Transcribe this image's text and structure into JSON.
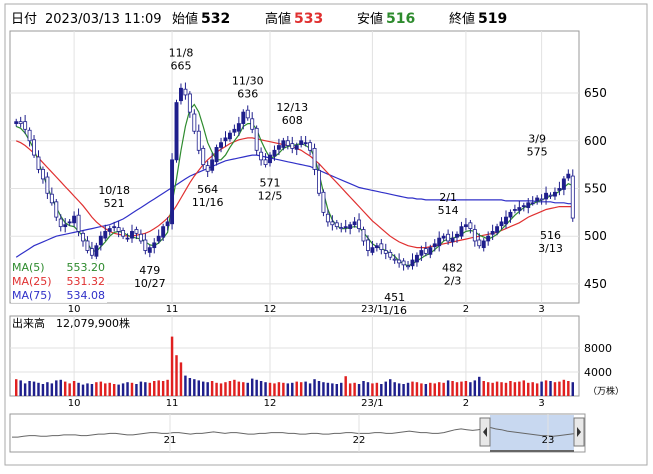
{
  "header": {
    "date_label": "日付",
    "datetime": "2023/03/13 11:09",
    "open_label": "始値",
    "open": "532",
    "high_label": "高値",
    "high": "533",
    "low_label": "安値",
    "low": "516",
    "close_label": "終値",
    "close": "519"
  },
  "colors": {
    "up_candle": "#1f1f8c",
    "down_candle": "#ffffff",
    "ma5": "#2e8b2e",
    "ma25": "#e03030",
    "ma75": "#3030c8",
    "volume": "#e02020",
    "high_text": "#e03030",
    "low_text": "#2e8b2e"
  },
  "chart_data": [
    {
      "type": "candlestick",
      "ylim": [
        430,
        715
      ],
      "yticks": [
        450,
        500,
        550,
        600,
        650
      ],
      "x_tick_labels": [
        "10",
        "11",
        "12",
        "23/1",
        "2",
        "3"
      ],
      "ma_legend": [
        {
          "label": "MA(5)",
          "value": "553.20"
        },
        {
          "label": "MA(25)",
          "value": "531.32"
        },
        {
          "label": "MA(75)",
          "value": "534.08"
        }
      ],
      "annotations": [
        {
          "date": "10/18",
          "value": "521"
        },
        {
          "date": "11/8",
          "value": "665"
        },
        {
          "date": "10/27",
          "value": "479"
        },
        {
          "date": "11/16",
          "value": "564"
        },
        {
          "date": "11/30",
          "value": "636"
        },
        {
          "date": "12/5",
          "value": "571"
        },
        {
          "date": "12/13",
          "value": "608"
        },
        {
          "date": "1/16",
          "value": "451"
        },
        {
          "date": "2/1",
          "value": "514"
        },
        {
          "date": "2/3",
          "value": "482"
        },
        {
          "date": "3/9",
          "value": "575"
        },
        {
          "date": "3/13",
          "value": "516"
        }
      ],
      "closes": [
        620,
        618,
        612,
        600,
        585,
        570,
        560,
        545,
        535,
        520,
        510,
        512,
        515,
        521,
        505,
        495,
        485,
        480,
        490,
        500,
        505,
        508,
        510,
        505,
        500,
        498,
        505,
        503,
        495,
        485,
        488,
        493,
        500,
        510,
        515,
        580,
        640,
        655,
        648,
        630,
        610,
        590,
        575,
        568,
        580,
        593,
        598,
        603,
        608,
        612,
        618,
        630,
        624,
        612,
        590,
        580,
        575,
        585,
        590,
        595,
        600,
        595,
        592,
        595,
        600,
        598,
        590,
        570,
        545,
        525,
        515,
        512,
        510,
        508,
        510,
        512,
        515,
        508,
        495,
        485,
        488,
        490,
        486,
        482,
        478,
        475,
        472,
        470,
        468,
        475,
        480,
        485,
        482,
        488,
        492,
        498,
        500,
        495,
        498,
        502,
        510,
        512,
        508,
        495,
        490,
        495,
        500,
        505,
        510,
        515,
        520,
        525,
        528,
        530,
        532,
        535,
        535,
        540,
        538,
        545,
        542,
        546,
        550,
        560,
        565,
        519
      ],
      "ma5": [
        615,
        613,
        608,
        600,
        591,
        578,
        565,
        552,
        540,
        530,
        521,
        514,
        511,
        510,
        505,
        500,
        493,
        485,
        484,
        489,
        494,
        500,
        504,
        505,
        504,
        501,
        499,
        498,
        497,
        494,
        491,
        490,
        493,
        498,
        504,
        535,
        560,
        590,
        615,
        633,
        638,
        630,
        615,
        598,
        588,
        580,
        580,
        585,
        593,
        600,
        606,
        615,
        618,
        618,
        612,
        600,
        590,
        582,
        583,
        587,
        592,
        594,
        595,
        596,
        597,
        595,
        592,
        583,
        566,
        546,
        528,
        517,
        511,
        508,
        508,
        509,
        510,
        509,
        504,
        498,
        492,
        489,
        487,
        485,
        482,
        479,
        474,
        471,
        469,
        471,
        474,
        477,
        480,
        482,
        486,
        490,
        495,
        497,
        498,
        499,
        502,
        505,
        506,
        505,
        501,
        499,
        497,
        499,
        502,
        507,
        512,
        517,
        522,
        526,
        530,
        532,
        534,
        536,
        538,
        540,
        542,
        544,
        547,
        551,
        555,
        553
      ],
      "ma25": [
        600,
        598,
        595,
        591,
        587,
        582,
        577,
        572,
        567,
        562,
        557,
        552,
        547,
        542,
        537,
        532,
        526,
        520,
        515,
        511,
        508,
        505,
        503,
        502,
        501,
        500,
        500,
        501,
        502,
        503,
        505,
        508,
        511,
        515,
        519,
        525,
        532,
        540,
        548,
        556,
        563,
        569,
        575,
        580,
        584,
        588,
        591,
        594,
        597,
        599,
        601,
        602,
        603,
        603,
        602,
        601,
        600,
        599,
        598,
        597,
        596,
        595,
        594,
        592,
        590,
        587,
        584,
        580,
        576,
        571,
        566,
        561,
        556,
        551,
        546,
        541,
        536,
        531,
        526,
        521,
        516,
        512,
        508,
        504,
        500,
        497,
        494,
        492,
        490,
        489,
        488,
        488,
        488,
        489,
        490,
        491,
        492,
        493,
        494,
        495,
        496,
        497,
        498,
        499,
        500,
        501,
        502,
        503,
        504,
        506,
        508,
        510,
        512,
        514,
        517,
        520,
        522,
        524,
        526,
        528,
        529,
        530,
        531,
        531,
        531,
        531
      ],
      "ma75": [
        478,
        481,
        484,
        487,
        490,
        492,
        494,
        496,
        498,
        500,
        501,
        502,
        503,
        504,
        505,
        506,
        507,
        508,
        509,
        510,
        511,
        512,
        514,
        516,
        518,
        521,
        524,
        527,
        530,
        533,
        536,
        539,
        542,
        545,
        548,
        551,
        554,
        557,
        560,
        563,
        565,
        567,
        569,
        571,
        573,
        575,
        577,
        579,
        580,
        581,
        582,
        583,
        584,
        585,
        585,
        584,
        583,
        582,
        581,
        580,
        579,
        578,
        577,
        576,
        575,
        574,
        573,
        571,
        569,
        567,
        565,
        563,
        561,
        559,
        557,
        555,
        553,
        551,
        550,
        549,
        548,
        547,
        546,
        545,
        544,
        543,
        542,
        541,
        540,
        540,
        539,
        539,
        538,
        538,
        538,
        538,
        538,
        538,
        538,
        538,
        538,
        538,
        538,
        538,
        538,
        538,
        538,
        538,
        538,
        538,
        537,
        537,
        537,
        537,
        537,
        537,
        537,
        536,
        536,
        536,
        536,
        535,
        535,
        535,
        534,
        534
      ]
    },
    {
      "type": "bar",
      "title": "出来高",
      "value_text": "12,079,900株",
      "unit": "（万株）",
      "yticks": [
        4000,
        8000
      ],
      "ylim": [
        0,
        11000
      ],
      "x_tick_labels": [
        "10",
        "11",
        "12",
        "23/1",
        "2",
        "3"
      ],
      "values": [
        2800,
        2600,
        2100,
        2500,
        2400,
        2200,
        2000,
        2300,
        2100,
        2600,
        2700,
        2400,
        2100,
        2500,
        2200,
        1900,
        2100,
        2000,
        2300,
        2400,
        2100,
        2200,
        2000,
        1900,
        2100,
        2300,
        2200,
        2000,
        2400,
        2300,
        2200,
        2500,
        2600,
        2500,
        2700,
        9900,
        6800,
        5600,
        3400,
        3000,
        2800,
        2600,
        2400,
        2300,
        2500,
        2200,
        2100,
        2300,
        2500,
        2700,
        2400,
        2300,
        2200,
        2900,
        2700,
        2500,
        2300,
        2200,
        2100,
        2300,
        2200,
        2100,
        2200,
        2400,
        2300,
        2400,
        2100,
        2800,
        2500,
        2300,
        2200,
        2100,
        2000,
        2200,
        3300,
        2100,
        2200,
        2000,
        2500,
        2300,
        2100,
        2200,
        2000,
        2400,
        2800,
        2300,
        2100,
        2000,
        2200,
        2400,
        2300,
        2100,
        2000,
        2200,
        2100,
        2300,
        2200,
        2600,
        2500,
        2300,
        2400,
        2500,
        2300,
        2600,
        3200,
        2500,
        2300,
        2200,
        2400,
        2300,
        2200,
        2500,
        2300,
        2400,
        2600,
        2200,
        2300,
        2100,
        2400,
        2600,
        2500,
        2300,
        2400,
        2700,
        2500,
        2300
      ]
    },
    {
      "type": "area",
      "x_tick_labels": [
        "21",
        "22",
        "23"
      ],
      "values": [
        52,
        52,
        53,
        54,
        54,
        53,
        53,
        54,
        54,
        55,
        55,
        55,
        54,
        54,
        55,
        56,
        56,
        57,
        57,
        56,
        55,
        55,
        56,
        57,
        58,
        58,
        57,
        57,
        58,
        58,
        57,
        56,
        57,
        57,
        58,
        59,
        58,
        57,
        58,
        58,
        57,
        56,
        56,
        57,
        57,
        58,
        58,
        58,
        57,
        57,
        56,
        56,
        57,
        57,
        56,
        56,
        57,
        57,
        58,
        58,
        57,
        57,
        57,
        58,
        58,
        57,
        57,
        58,
        59,
        60,
        59,
        58,
        58,
        57,
        57,
        58,
        60,
        62,
        63,
        62,
        61,
        62,
        64,
        65,
        63,
        62,
        60,
        59,
        58,
        57,
        56,
        55,
        54,
        54,
        53,
        54,
        55,
        56,
        57,
        58
      ]
    }
  ]
}
